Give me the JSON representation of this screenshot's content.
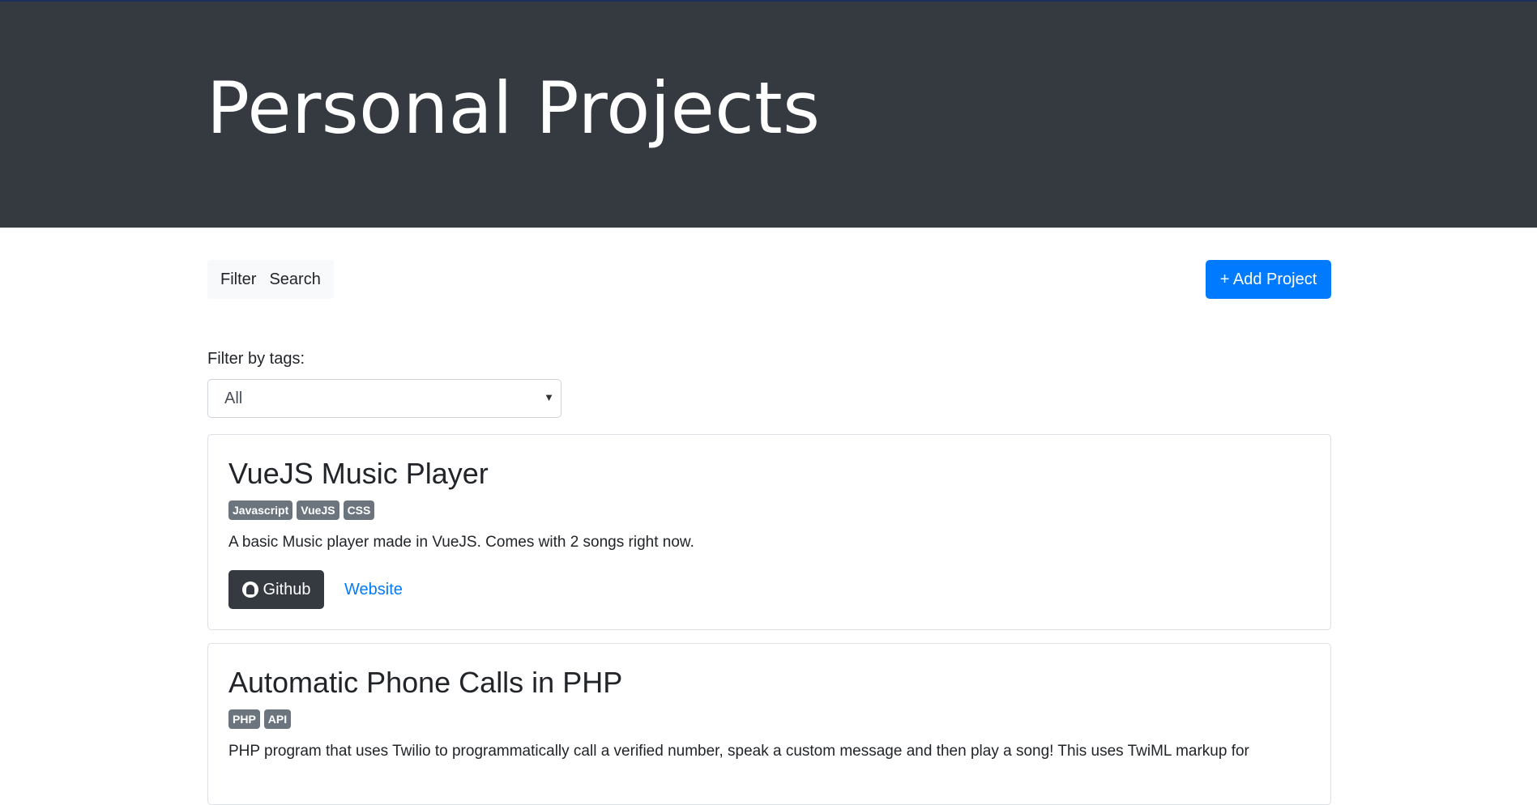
{
  "header": {
    "title": "Personal Projects"
  },
  "tabs": [
    {
      "label": "Filter"
    },
    {
      "label": "Search"
    }
  ],
  "add_button": {
    "label": "+ Add Project"
  },
  "filter": {
    "label": "Filter by tags:",
    "selected": "All"
  },
  "projects": [
    {
      "title": "VueJS Music Player",
      "tags": [
        "Javascript",
        "VueJS",
        "CSS"
      ],
      "description": "A basic Music player made in VueJS. Comes with 2 songs right now.",
      "github_label": "Github",
      "website_label": "Website"
    },
    {
      "title": "Automatic Phone Calls in PHP",
      "tags": [
        "PHP",
        "API"
      ],
      "description": "PHP program that uses Twilio to programmatically call a verified number, speak a custom message and then play a song! This uses TwiML markup for"
    }
  ],
  "colors": {
    "header_bg": "#343a40",
    "primary": "#007bff",
    "badge": "#6c757d",
    "dark_button": "#343a40"
  }
}
